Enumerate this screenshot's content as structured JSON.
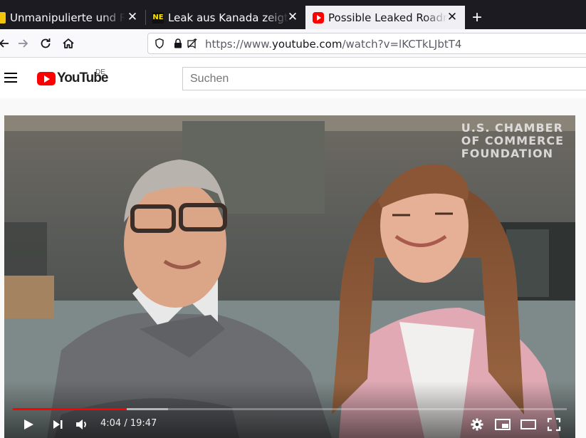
{
  "browser": {
    "tabs": [
      {
        "title": "Unmanipulierte und Freie",
        "favicon": "news-icon",
        "active": false
      },
      {
        "title": "Leak aus Kanada zeigt die",
        "favicon": "ne-icon",
        "favicon_text": "NE",
        "active": false
      },
      {
        "title": "Possible Leaked Roadmap",
        "favicon": "youtube-icon",
        "active": true
      }
    ],
    "close_glyph": "✕",
    "new_tab_glyph": "+",
    "url": {
      "scheme": "https://www.",
      "domain": "youtube.com",
      "path": "/watch?v=lKCTkLJbtT4"
    }
  },
  "youtube": {
    "logo_text": "YouTube",
    "country_code": "DE",
    "search_placeholder": "Suchen"
  },
  "video": {
    "watermark_line1": "U.S. CHAMBER",
    "watermark_line2": "OF COMMERCE",
    "watermark_line3": "FOUNDATION",
    "current_time": "4:04",
    "duration": "19:47",
    "time_display": "4:04 / 19:47",
    "played_fraction": 0.206,
    "loaded_fraction": 0.28
  },
  "colors": {
    "chrome_dark": "#1c1b22",
    "active_tab": "#f0f0f4",
    "yt_red": "#ff0000"
  }
}
